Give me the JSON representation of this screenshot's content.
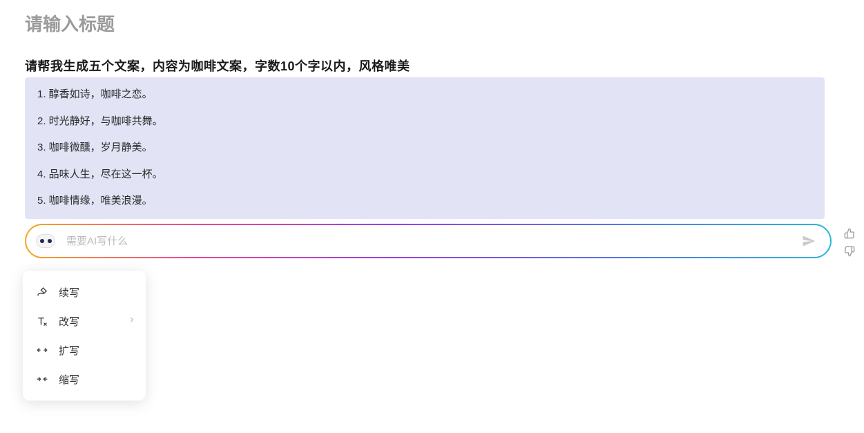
{
  "title_placeholder": "请输入标题",
  "prompt": "请帮我生成五个文案，内容为咖啡文案，字数10个字以内，风格唯美",
  "results": [
    "1. 醇香如诗，咖啡之恋。",
    "2. 时光静好，与咖啡共舞。",
    "3. 咖啡微醺，岁月静美。",
    "4. 品味人生，尽在这一杯。",
    "5. 咖啡情缘，唯美浪漫。"
  ],
  "ai_input_placeholder": "需要AI写什么",
  "actions": [
    {
      "label": "续写",
      "icon": "continue",
      "has_sub": false
    },
    {
      "label": "改写",
      "icon": "rewrite",
      "has_sub": true
    },
    {
      "label": "扩写",
      "icon": "expand",
      "has_sub": false
    },
    {
      "label": "缩写",
      "icon": "shrink",
      "has_sub": false
    }
  ]
}
